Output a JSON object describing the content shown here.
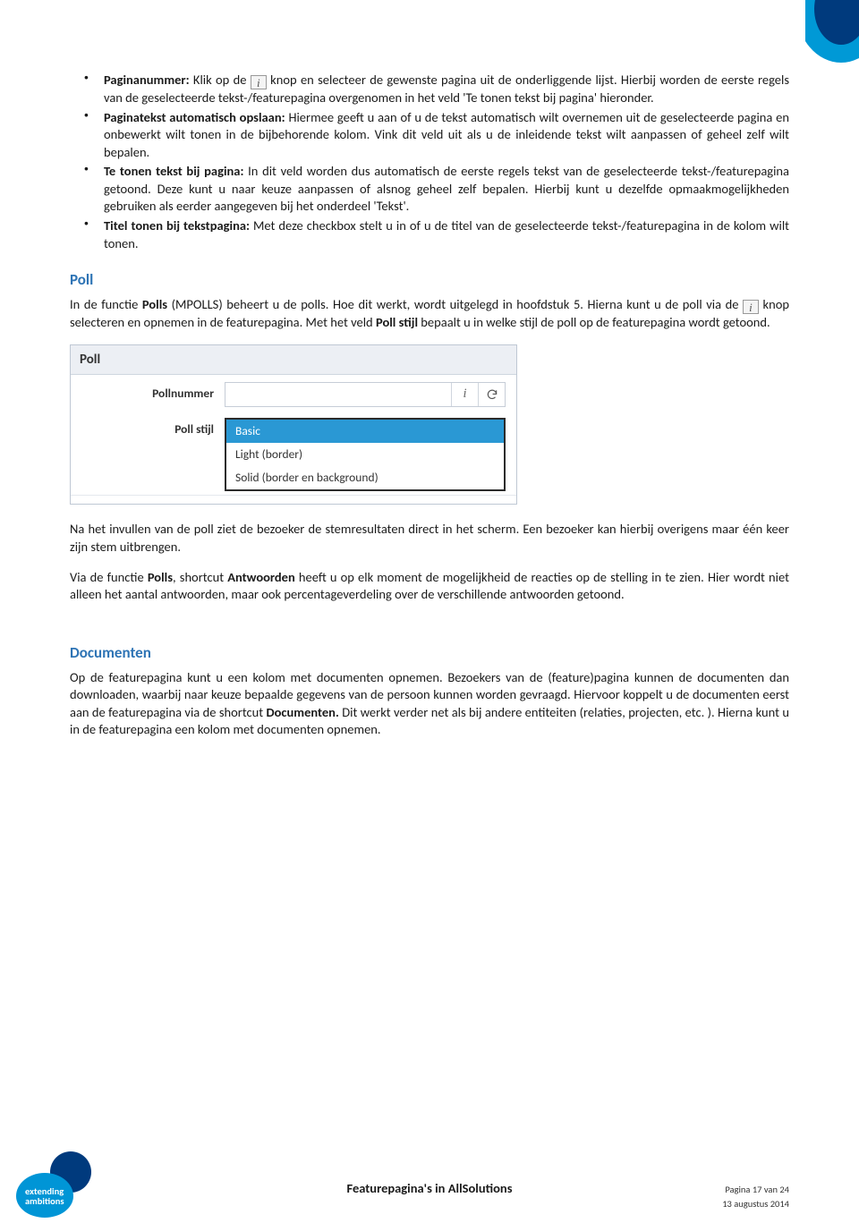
{
  "bullets": [
    {
      "label": "Paginanummer:",
      "pre": " Klik op de ",
      "post": " knop en selecteer de gewenste pagina uit de onderliggende lijst. Hierbij worden de eerste regels van de geselecteerde tekst-/featurepagina overgenomen in het veld 'Te tonen tekst bij pagina' hieronder."
    },
    {
      "label": "Paginatekst automatisch opslaan:",
      "text": " Hiermee geeft u aan of u de tekst automatisch wilt overnemen uit de geselecteerde pagina en onbewerkt wilt tonen in de bijbehorende kolom. Vink dit veld uit als u de inleidende tekst wilt aanpassen of geheel zelf wilt bepalen."
    },
    {
      "label": "Te tonen tekst bij pagina:",
      "text": " In dit veld worden dus automatisch de eerste regels tekst van de geselecteerde tekst-/featurepagina getoond. Deze kunt u naar keuze aanpassen of alsnog geheel zelf bepalen. Hierbij kunt u dezelfde opmaakmogelijkheden gebruiken als eerder aangegeven bij het onderdeel 'Tekst'."
    },
    {
      "label": "Titel tonen bij tekstpagina:",
      "text": " Met deze checkbox stelt u in of u de titel van de geselecteerde tekst-/featurepagina in de kolom wilt tonen."
    }
  ],
  "poll": {
    "heading": "Poll",
    "intro_a": "In de functie ",
    "intro_b": "Polls",
    "intro_c": " (MPOLLS) beheert u de polls. Hoe dit werkt, wordt uitgelegd in hoofdstuk 5. Hierna kunt u de poll via de ",
    "intro_d": " knop selecteren en opnemen in de featurepagina. Met het veld ",
    "intro_e": "Poll stijl",
    "intro_f": " bepaalt u in welke stijl de poll op de featurepagina wordt getoond.",
    "panel": {
      "title": "Poll",
      "field1_label": "Pollnummer",
      "field2_label": "Poll stijl",
      "options": [
        "Basic",
        "Light (border)",
        "Solid (border en background)"
      ]
    },
    "after1": "Na het invullen van de poll ziet de bezoeker de stemresultaten direct in het scherm. Een bezoeker kan hierbij overigens maar één keer zijn stem uitbrengen.",
    "after2_a": "Via de functie ",
    "after2_b": "Polls",
    "after2_c": ", shortcut ",
    "after2_d": "Antwoorden",
    "after2_e": " heeft u op elk moment de mogelijkheid de reacties op de stelling in te zien. Hier wordt niet alleen het aantal antwoorden, maar ook percentageverdeling over de verschillende antwoorden getoond."
  },
  "documents": {
    "heading": "Documenten",
    "para_a": "Op de featurepagina kunt u een kolom met documenten opnemen. Bezoekers van de (feature)pagina kunnen de documenten dan downloaden, waarbij naar keuze bepaalde gegevens van de persoon kunnen worden gevraagd. Hiervoor koppelt u de documenten eerst aan de featurepagina via de shortcut ",
    "para_b": "Documenten.",
    "para_c": " Dit werkt verder net als bij andere entiteiten (relaties, projecten, etc. ). Hierna kunt u in de featurepagina een kolom met documenten opnemen."
  },
  "footer": {
    "title": "Featurepagina's in AllSolutions",
    "page": "Pagina 17 van 24",
    "date": "13 augustus 2014"
  },
  "logo": {
    "line1": "extending",
    "line2": "ambitions"
  }
}
